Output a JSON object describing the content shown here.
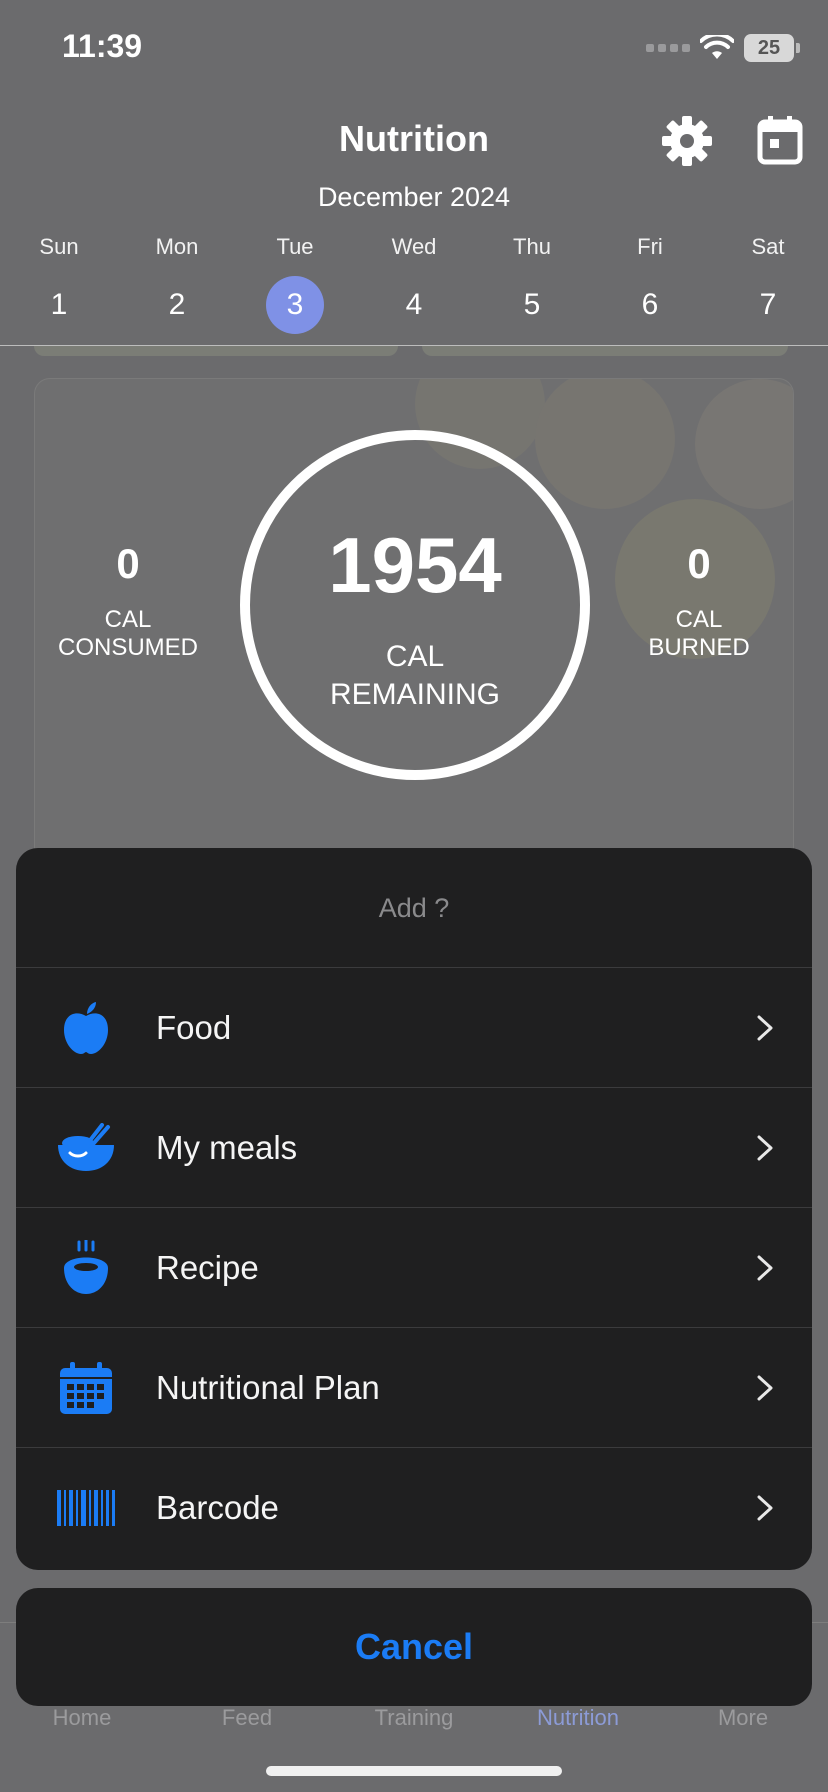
{
  "status_bar": {
    "time": "11:39",
    "battery": "25"
  },
  "header": {
    "title": "Nutrition",
    "month": "December 2024"
  },
  "week": [
    {
      "name": "Sun",
      "num": "1"
    },
    {
      "name": "Mon",
      "num": "2"
    },
    {
      "name": "Tue",
      "num": "3",
      "selected": true
    },
    {
      "name": "Wed",
      "num": "4"
    },
    {
      "name": "Thu",
      "num": "5"
    },
    {
      "name": "Fri",
      "num": "6"
    },
    {
      "name": "Sat",
      "num": "7"
    }
  ],
  "summary": {
    "consumed_value": "0",
    "consumed_label": "CAL\nCONSUMED",
    "remaining_value": "1954",
    "remaining_label": "CAL\nREMAINING",
    "burned_value": "0",
    "burned_label": "CAL\nBURNED"
  },
  "action_sheet": {
    "title": "Add ?",
    "items": [
      {
        "label": "Food",
        "icon": "apple-icon"
      },
      {
        "label": "My meals",
        "icon": "bowl-icon"
      },
      {
        "label": "Recipe",
        "icon": "steaming-pot-icon"
      },
      {
        "label": "Nutritional Plan",
        "icon": "calendar-grid-icon"
      },
      {
        "label": "Barcode",
        "icon": "barcode-icon"
      }
    ],
    "cancel": "Cancel"
  },
  "tabbar": {
    "items": [
      {
        "label": "Home"
      },
      {
        "label": "Feed"
      },
      {
        "label": "Training"
      },
      {
        "label": "Nutrition",
        "active": true
      },
      {
        "label": "More"
      }
    ]
  },
  "colors": {
    "accent": "#1b7cf5",
    "selected_day": "#7f91e6",
    "sheet_bg": "#1f1f20",
    "overlay_bg": "#6b6b6d"
  }
}
